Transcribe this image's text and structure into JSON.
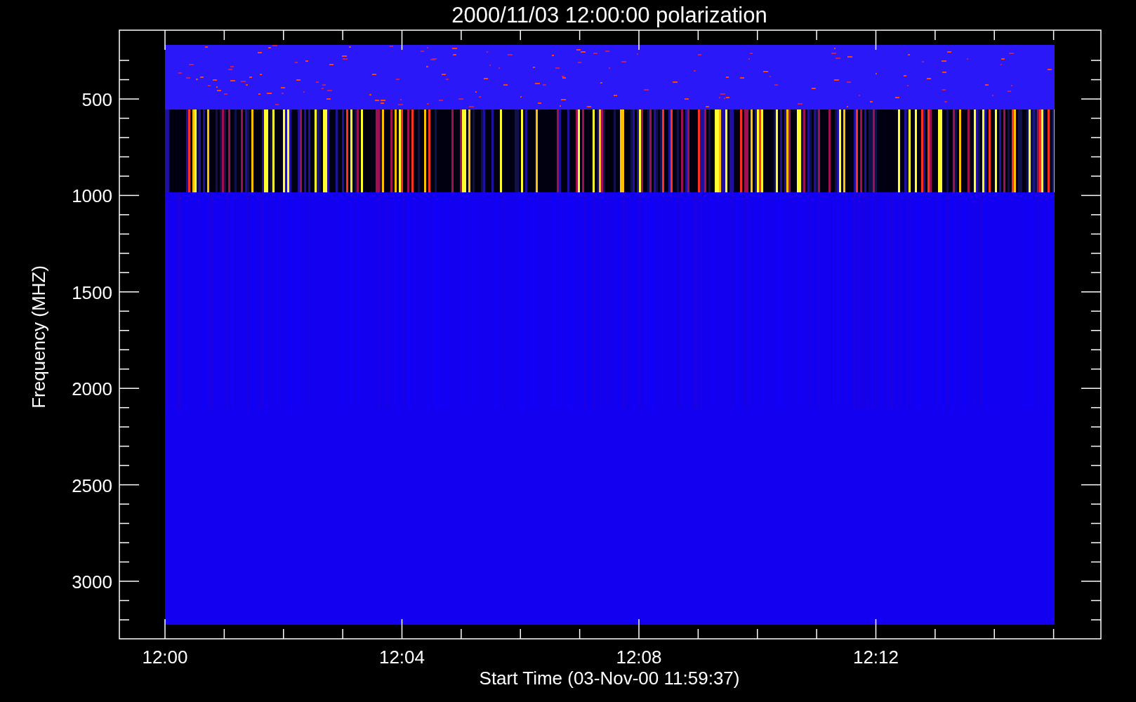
{
  "title": "2000/11/03 12:00:00 polarization",
  "x_axis": {
    "label": "Start Time (03-Nov-00 11:59:37)",
    "tick_labels": [
      "12:00",
      "12:04",
      "12:08",
      "12:12"
    ]
  },
  "y_axis": {
    "label": "Frequency (MHZ)",
    "tick_labels": [
      "500",
      "1000",
      "1500",
      "2000",
      "2500",
      "3000"
    ]
  }
}
